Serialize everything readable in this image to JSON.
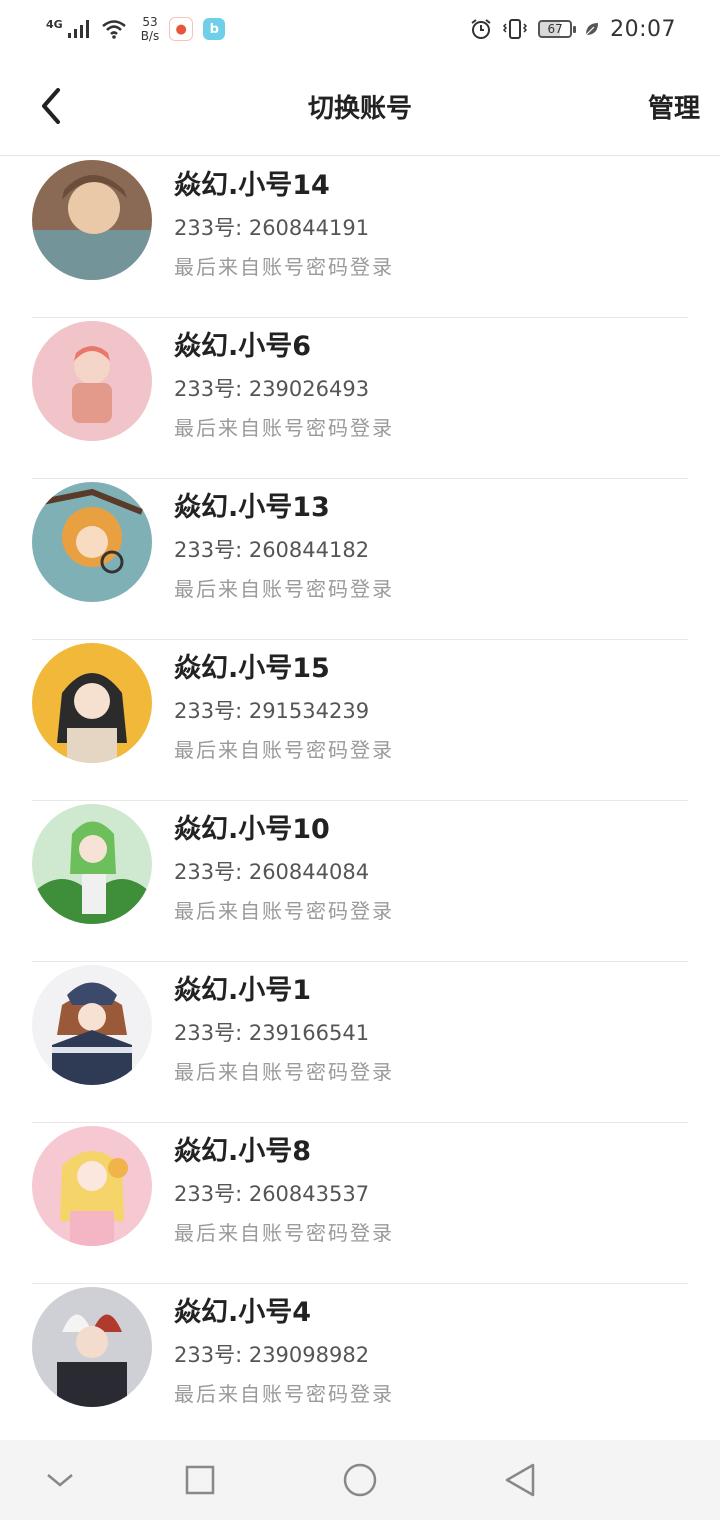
{
  "status_bar": {
    "network": "4G",
    "speed_value": "53",
    "speed_unit": "B/s",
    "battery": "67",
    "time": "20:07",
    "icons": [
      "signal-icon",
      "wifi-icon",
      "app-notification-icon",
      "bilibili-icon",
      "alarm-icon",
      "vibrate-icon",
      "battery-icon",
      "leaf-icon"
    ]
  },
  "header": {
    "title": "切换账号",
    "manage": "管理"
  },
  "accounts": [
    {
      "name": "焱幻.小号14",
      "uid": "233号: 260844191",
      "hint": "最后来自账号密码登录",
      "avatar_color": "#8a6a54"
    },
    {
      "name": "焱幻.小号6",
      "uid": "233号: 239026493",
      "hint": "最后来自账号密码登录",
      "avatar_color": "#f0c4c8"
    },
    {
      "name": "焱幻.小号13",
      "uid": "233号: 260844182",
      "hint": "最后来自账号密码登录",
      "avatar_color": "#e8a040"
    },
    {
      "name": "焱幻.小号15",
      "uid": "233号: 291534239",
      "hint": "最后来自账号密码登录",
      "avatar_color": "#f2b83a"
    },
    {
      "name": "焱幻.小号10",
      "uid": "233号: 260844084",
      "hint": "最后来自账号密码登录",
      "avatar_color": "#6cbf5a"
    },
    {
      "name": "焱幻.小号1",
      "uid": "233号: 239166541",
      "hint": "最后来自账号密码登录",
      "avatar_color": "#3b4a6b"
    },
    {
      "name": "焱幻.小号8",
      "uid": "233号: 260843537",
      "hint": "最后来自账号密码登录",
      "avatar_color": "#f6c8d2"
    },
    {
      "name": "焱幻.小号4",
      "uid": "233号: 239098982",
      "hint": "最后来自账号密码登录",
      "avatar_color": "#2a2a33"
    }
  ],
  "navbar": {
    "icons": [
      "chevron-down-icon",
      "square-icon",
      "circle-home-icon",
      "triangle-back-icon"
    ]
  }
}
